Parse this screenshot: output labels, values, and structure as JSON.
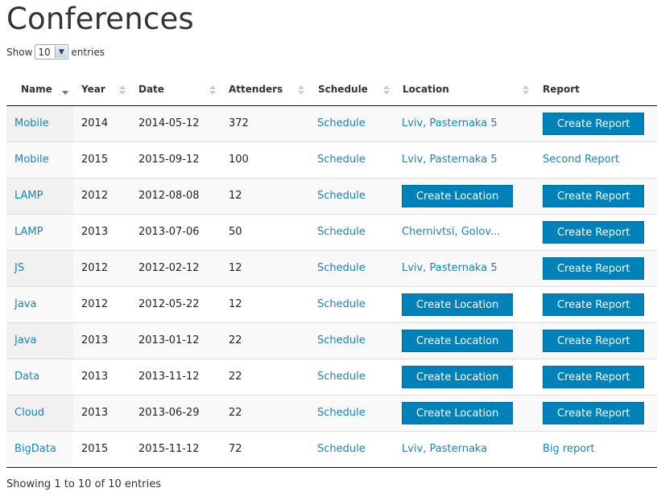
{
  "page": {
    "title": "Conferences"
  },
  "length_menu": {
    "show_label": "Show",
    "selected": "10",
    "entries_label": "entries"
  },
  "table": {
    "headers": [
      "Name",
      "Year",
      "Date",
      "Attenders",
      "Schedule",
      "Location",
      "Report"
    ],
    "sorted_column": "Name",
    "sort_direction": "descending",
    "rows": [
      {
        "name": "Mobile",
        "year": "2014",
        "date": "2014-05-12",
        "attenders": "372",
        "schedule": "Schedule",
        "location": {
          "type": "link",
          "text": "Lviv, Pasternaka 5"
        },
        "report": {
          "type": "button",
          "text": "Create Report"
        }
      },
      {
        "name": "Mobile",
        "year": "2015",
        "date": "2015-09-12",
        "attenders": "100",
        "schedule": "Schedule",
        "location": {
          "type": "link",
          "text": "Lviv, Pasternaka 5"
        },
        "report": {
          "type": "link",
          "text": "Second Report"
        }
      },
      {
        "name": "LAMP",
        "year": "2012",
        "date": "2012-08-08",
        "attenders": "12",
        "schedule": "Schedule",
        "location": {
          "type": "button",
          "text": "Create Location"
        },
        "report": {
          "type": "button",
          "text": "Create Report"
        }
      },
      {
        "name": "LAMP",
        "year": "2013",
        "date": "2013-07-06",
        "attenders": "50",
        "schedule": "Schedule",
        "location": {
          "type": "link",
          "text": "Chernivtsi, Golov..."
        },
        "report": {
          "type": "button",
          "text": "Create Report"
        }
      },
      {
        "name": "JS",
        "year": "2012",
        "date": "2012-02-12",
        "attenders": "12",
        "schedule": "Schedule",
        "location": {
          "type": "link",
          "text": "Lviv, Pasternaka 5"
        },
        "report": {
          "type": "button",
          "text": "Create Report"
        }
      },
      {
        "name": "Java",
        "year": "2012",
        "date": "2012-05-22",
        "attenders": "12",
        "schedule": "Schedule",
        "location": {
          "type": "button",
          "text": "Create Location"
        },
        "report": {
          "type": "button",
          "text": "Create Report"
        }
      },
      {
        "name": "Java",
        "year": "2013",
        "date": "2013-01-12",
        "attenders": "22",
        "schedule": "Schedule",
        "location": {
          "type": "button",
          "text": "Create Location"
        },
        "report": {
          "type": "button",
          "text": "Create Report"
        }
      },
      {
        "name": "Data",
        "year": "2013",
        "date": "2013-11-12",
        "attenders": "22",
        "schedule": "Schedule",
        "location": {
          "type": "button",
          "text": "Create Location"
        },
        "report": {
          "type": "button",
          "text": "Create Report"
        }
      },
      {
        "name": "Cloud",
        "year": "2013",
        "date": "2013-06-29",
        "attenders": "22",
        "schedule": "Schedule",
        "location": {
          "type": "button",
          "text": "Create Location"
        },
        "report": {
          "type": "button",
          "text": "Create Report"
        }
      },
      {
        "name": "BigData",
        "year": "2015",
        "date": "2015-11-12",
        "attenders": "72",
        "schedule": "Schedule",
        "location": {
          "type": "link",
          "text": "Lviv, Pasternaka"
        },
        "report": {
          "type": "link",
          "text": "Big report"
        }
      }
    ]
  },
  "footer": {
    "info": "Showing 1 to 10 of 10 entries"
  },
  "colors": {
    "link": "#1a83b8",
    "button_bg": "#0082b8",
    "sort_active": "#6a6fb2"
  }
}
